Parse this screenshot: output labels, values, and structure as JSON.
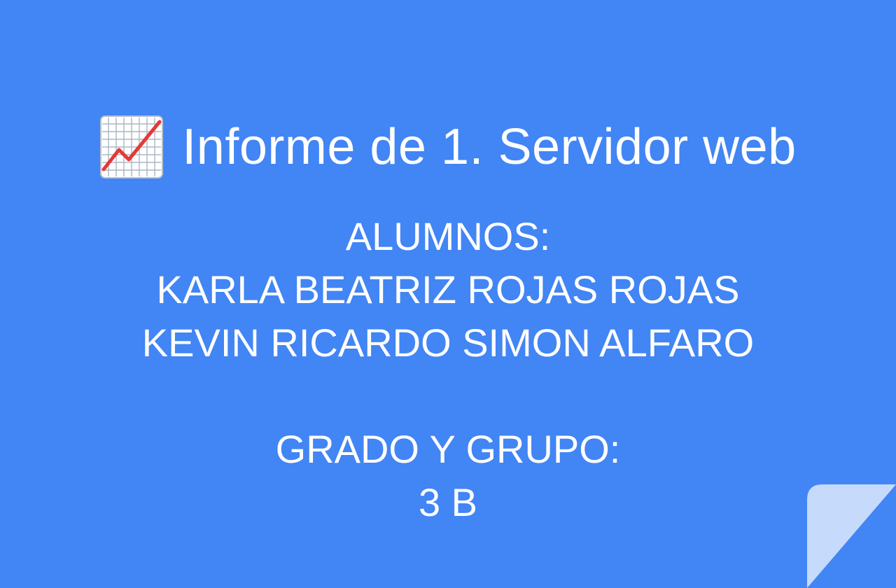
{
  "slide": {
    "background_color": "#4285f4",
    "title": {
      "icon": "chart-increasing-icon",
      "text": "Informe de 1. Servidor web"
    },
    "students": {
      "heading": "ALUMNOS:",
      "names": [
        "KARLA BEATRIZ ROJAS ROJAS",
        "KEVIN RICARDO SIMON ALFARO"
      ]
    },
    "group": {
      "heading": "GRADO Y GRUPO:",
      "value": "3 B"
    },
    "page_curl_color": "#c6dafc"
  }
}
